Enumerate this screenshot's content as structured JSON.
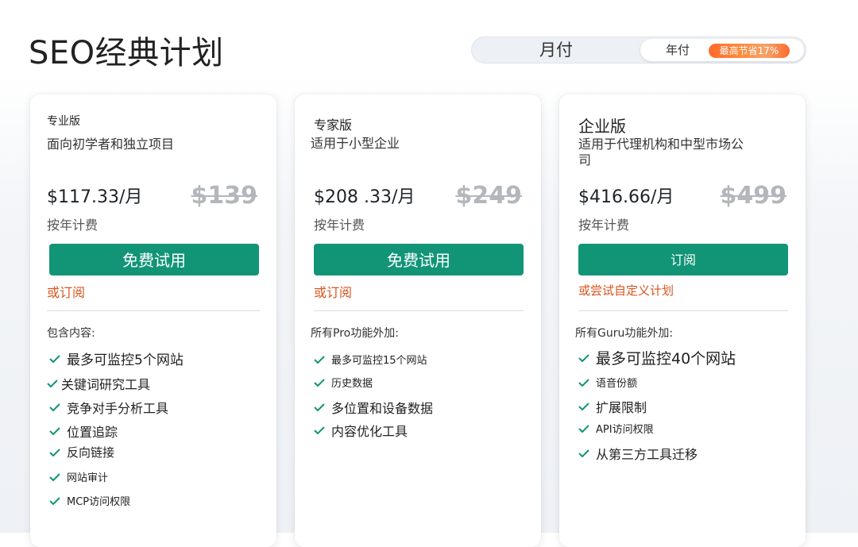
{
  "page": {
    "title": "SEO经典计划"
  },
  "billing": {
    "monthly_label": "月付",
    "yearly_label": "年付",
    "save_badge": "最高节省17%"
  },
  "colors": {
    "accent_green": "#129477",
    "link_orange": "#d9541e",
    "badge_orange": "#ff6a2a",
    "old_price_gray": "#b3b7bc"
  },
  "plans": [
    {
      "name": "专业版",
      "description": "面向初学者和独立项目",
      "price": "$117.33/月",
      "old_price": "$139",
      "billing_note": "按年计费",
      "cta": "免费试用",
      "alt_link": "或订阅",
      "features_heading": "包含内容:",
      "features": [
        "最多可监控5个网站",
        "关键词研究工具",
        "竞争对手分析工具",
        "位置追踪",
        "反向链接",
        "网站审计",
        "MCP访问权限"
      ]
    },
    {
      "name": "专家版",
      "description": "适用于小型企业",
      "price": "$208 .33/月",
      "old_price": "$249",
      "billing_note": "按年计费",
      "cta": "免费试用",
      "alt_link": "或订阅",
      "features_heading": "所有Pro功能外加:",
      "features": [
        "最多可监控15个网站",
        "历史数据",
        "多位置和设备数据",
        "内容优化工具"
      ]
    },
    {
      "name": "企业版",
      "description": "适用于代理机构和中型市场公司",
      "price": "$416.66/月",
      "old_price": "$499",
      "billing_note": "按年计费",
      "cta": "订阅",
      "alt_link": "或尝试自定义计划",
      "features_heading": "所有Guru功能外加:",
      "features": [
        "最多可监控40个网站",
        "语音份额",
        "扩展限制",
        "API访问权限",
        "从第三方工具迁移"
      ]
    }
  ]
}
